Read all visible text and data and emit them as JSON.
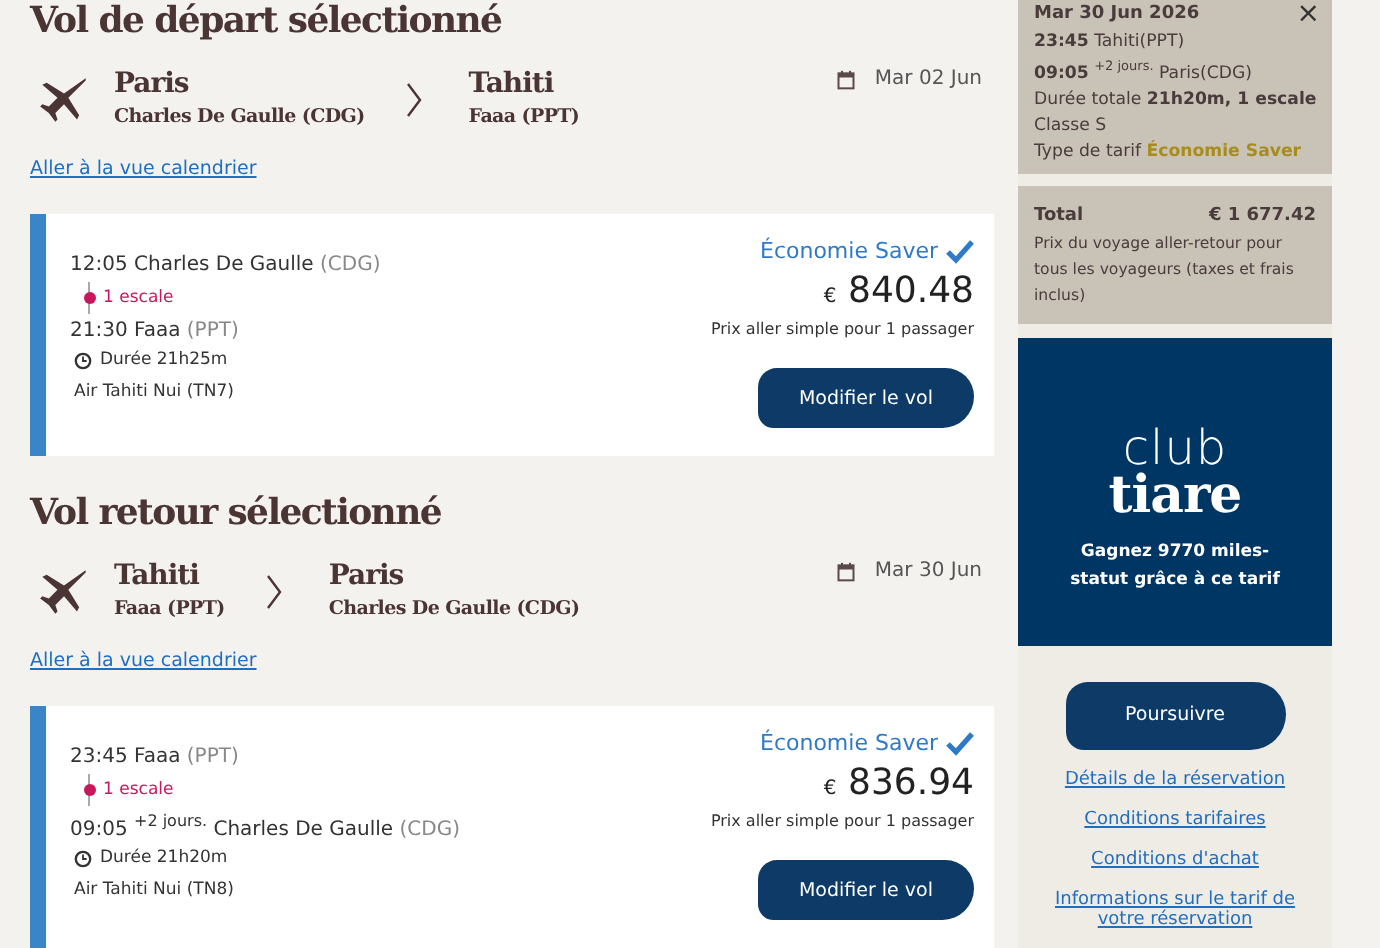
{
  "outbound": {
    "heading": "Vol de départ sélectionné",
    "origin": {
      "city": "Paris",
      "airport": "Charles De Gaulle (CDG)"
    },
    "destination": {
      "city": "Tahiti",
      "airport": "Faaa (PPT)"
    },
    "date": "Mar 02 Jun",
    "calendar_link": "Aller à la vue calendrier",
    "flight": {
      "depart_time": "12:05",
      "depart_airport": "Charles De Gaulle",
      "depart_code": "(CDG)",
      "stops": "1 escale",
      "arrive_time": "21:30",
      "arrive_airport": "Faaa",
      "arrive_code": "(PPT)",
      "duration": "Durée 21h25m",
      "airline": "Air Tahiti Nui (TN7)",
      "fare": "Économie Saver",
      "fare_selected": true,
      "currency": "€",
      "price": "840.48",
      "price_note": "Prix aller simple pour 1 passager",
      "button": "Modifier le vol"
    }
  },
  "return": {
    "heading": "Vol retour sélectionné",
    "origin": {
      "city": "Tahiti",
      "airport": "Faaa (PPT)"
    },
    "destination": {
      "city": "Paris",
      "airport": "Charles De Gaulle (CDG)"
    },
    "date": "Mar 30 Jun",
    "calendar_link": "Aller à la vue calendrier",
    "flight": {
      "depart_time": "23:45",
      "depart_airport": "Faaa",
      "depart_code": "(PPT)",
      "stops": "1 escale",
      "arrive_time": "09:05",
      "arrive_offset": "+2 jours.",
      "arrive_airport": "Charles De Gaulle",
      "arrive_code": "(CDG)",
      "duration": "Durée 21h20m",
      "airline": "Air Tahiti Nui (TN8)",
      "fare": "Économie Saver",
      "fare_selected": true,
      "currency": "€",
      "price": "836.94",
      "price_note": "Prix aller simple pour 1 passager",
      "button": "Modifier le vol"
    }
  },
  "sidebar": {
    "summary": {
      "date": "Mar 30 Jun 2026",
      "close": "×",
      "lines": [
        "**23:45** Tahiti(PPT)",
        "**09:05** $^{+2 jours.}$ Paris(CDG)",
        "Durée totale **21h20m, 1 escale**",
        "Classe S"
      ],
      "fare_label": "Type de tarif",
      "fare_value": "Économie Saver"
    },
    "total": {
      "label": "Total",
      "amount": "€ 1 677.42",
      "note": "Prix du voyage aller-retour pour tous les voyageurs (taxes et frais inclus)"
    },
    "promo": {
      "logo_top": "club",
      "logo_bottom": "tiare",
      "text": "Gagnez 9770 miles-statut grâce à ce tarif"
    },
    "continue_button": "Poursuivre",
    "links": [
      "Détails de la réservation",
      "Conditions tarifaires",
      "Conditions d'achat",
      "Informations sur le tarif de votre réservation"
    ]
  }
}
